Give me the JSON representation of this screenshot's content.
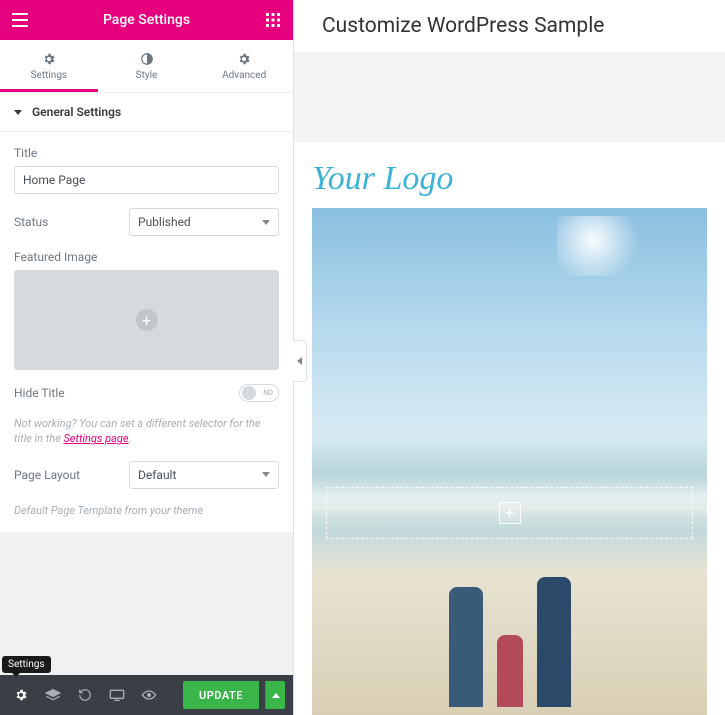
{
  "header": {
    "title": "Page Settings"
  },
  "tabs": [
    {
      "label": "Settings",
      "active": true
    },
    {
      "label": "Style",
      "active": false
    },
    {
      "label": "Advanced",
      "active": false
    }
  ],
  "section": {
    "title": "General Settings",
    "title_label": "Title",
    "title_value": "Home Page",
    "status_label": "Status",
    "status_value": "Published",
    "featured_image_label": "Featured Image",
    "hide_title_label": "Hide Title",
    "hide_title_toggle_off": "NO",
    "hint_prefix": "Not working? You can set a different selector for the title in the ",
    "hint_link": "Settings page",
    "page_layout_label": "Page Layout",
    "page_layout_value": "Default",
    "template_hint": "Default Page Template from your theme"
  },
  "footer": {
    "tooltip": "Settings",
    "update_label": "UPDATE"
  },
  "preview": {
    "title": "Customize WordPress Sample",
    "logo": "Your Logo"
  }
}
